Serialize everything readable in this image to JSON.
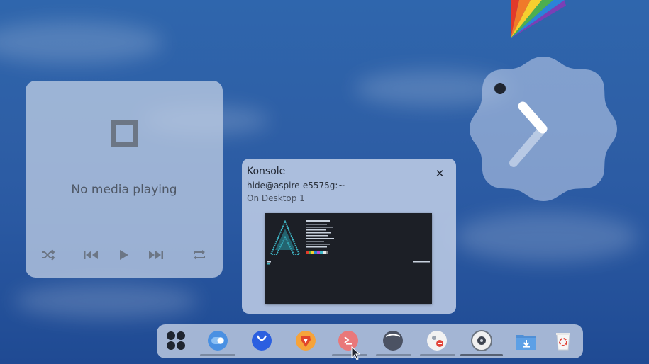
{
  "media_player": {
    "status": "No media playing",
    "controls": [
      "shuffle",
      "previous",
      "play",
      "next",
      "repeat"
    ]
  },
  "tooltip": {
    "app_name": "Konsole",
    "window_title": "hide@aspire-e5575g:~",
    "desktop": "On Desktop 1",
    "close_glyph": "✕"
  },
  "dock": {
    "items": [
      "app-launcher",
      "toggle-settings",
      "discover-store",
      "brave-browser",
      "konsole-terminal",
      "audio-app",
      "system-settings",
      "disk-app",
      "file-manager-downloads",
      "trash"
    ]
  },
  "colors": {
    "accent": "#3b82d8",
    "brave": "#f6a33a",
    "konsole": "#e9787a"
  }
}
